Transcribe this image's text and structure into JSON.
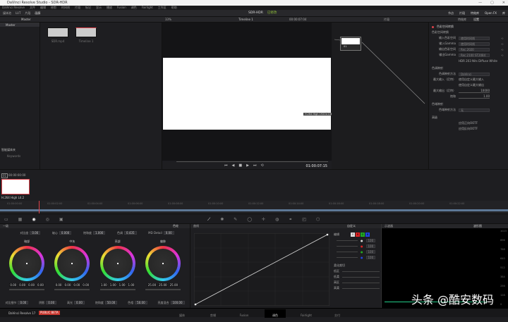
{
  "window": {
    "title": "DaVinci Resolve Studio - SDR-HDR",
    "controls": [
      "—",
      "▢",
      "✕"
    ]
  },
  "menu": [
    "DaVinci Resolve",
    "文件",
    "编辑",
    "修剪",
    "时间线",
    "片段",
    "标记",
    "显示",
    "播放",
    "Fusion",
    "调色",
    "Fairlight",
    "工作区",
    "帮助"
  ],
  "toolbar": {
    "left": [
      "媒体池",
      "LUT",
      "片段",
      "画廊"
    ],
    "project": "SDR-HDR",
    "status": "已修改",
    "right": [
      "节点",
      "片段",
      "特效库",
      "Open FX",
      "库"
    ]
  },
  "media_pool": {
    "header": "Master",
    "bin": "Master",
    "clips": [
      "SDR.mp4",
      "Timeline 1"
    ],
    "smart_bins": "智能媒体夹",
    "keywords": "Keywords"
  },
  "viewer": {
    "zoom": "33%",
    "timeline": "Timeline 1",
    "timecode_top": "00:00:07:04",
    "timecode": "01:00:07:15",
    "overlay": "H.264 High 1920×1080"
  },
  "nodes": {
    "mode": "片段",
    "node_label": "01"
  },
  "right_panel": {
    "tabs": [
      "特效库",
      "设置"
    ],
    "section1": "色彩空间转换",
    "group_input": "色彩空间转换",
    "rows": [
      {
        "label": "输入色彩空间",
        "value": "使用时间线"
      },
      {
        "label": "输入Gamma",
        "value": "使用时间线"
      },
      {
        "label": "输出色彩空间",
        "value": "Rec.2020"
      },
      {
        "label": "输出Gamma",
        "value": "Rec.2100 ST2084"
      }
    ],
    "hdr_note": "HDR 203 Nits Diffuse White",
    "tone_section": "色调映射",
    "tone_rows": [
      {
        "label": "色调映射方法",
        "value": "DaVinci"
      },
      {
        "label": "最大输入（尼特）",
        "value": "使用自定义最大输入"
      },
      {
        "label": "",
        "value": "使用自定义最大输出"
      },
      {
        "label": "最大输出（尼特）",
        "value": "10000"
      },
      {
        "label": "饱和",
        "value": "1.00"
      }
    ],
    "gamut_section": "色域映射",
    "gamut_row": {
      "label": "色域映射方法",
      "value": "无"
    },
    "adv_section": "高级",
    "checks": [
      "应用正向OOTF",
      "应用反向OOTF"
    ]
  },
  "clip_strip": {
    "clip_num": "01",
    "timecode": "00:00:00:00",
    "codec": "H.264 High L4.2"
  },
  "ruler": [
    "01:00:00:00",
    "01:00:02:00",
    "01:00:04:00",
    "01:00:06:00",
    "01:00:08:00",
    "01:00:10:00",
    "01:00:12:00",
    "01:00:14:00",
    "01:00:16:00",
    "01:00:18:00",
    "01:00:20:00",
    "01:00:22:00"
  ],
  "primaries": {
    "title": "一级",
    "mode": "色轮",
    "top": [
      {
        "label": "对比度",
        "value": "0.00"
      },
      {
        "label": "轴心",
        "value": "0.000"
      },
      {
        "label": "饱和度",
        "value": "1.000"
      },
      {
        "label": "色调",
        "value": "0.435"
      },
      {
        "label": "MD Detail",
        "value": "0.00"
      }
    ],
    "wheels": [
      {
        "name": "暗部",
        "values": [
          "0.00",
          "0.00",
          "0.00",
          "0.00"
        ]
      },
      {
        "name": "中灰",
        "values": [
          "0.00",
          "0.00",
          "0.00",
          "0.00"
        ]
      },
      {
        "name": "亮部",
        "values": [
          "1.00",
          "1.00",
          "1.00",
          "1.00"
        ]
      },
      {
        "name": "偏移",
        "values": [
          "25.00",
          "25.00",
          "25.00"
        ]
      }
    ],
    "bottom": [
      {
        "label": "对比细节",
        "value": "0.00"
      },
      {
        "label": "阴影",
        "value": "0.00"
      },
      {
        "label": "高光",
        "value": "0.00"
      },
      {
        "label": "饱和度",
        "value": "50.00"
      },
      {
        "label": "色相",
        "value": "50.00"
      },
      {
        "label": "亮度混合",
        "value": "100.00"
      }
    ]
  },
  "curves": {
    "title": "曲线",
    "mode": "自定义",
    "edit": "编辑",
    "channels": [
      "Y",
      "R",
      "G",
      "B"
    ],
    "values": [
      "100",
      "100",
      "100",
      "100"
    ],
    "soft_clip": "柔化裁切",
    "sliders": [
      "低区",
      "低柔",
      "高区",
      "高柔"
    ]
  },
  "scope": {
    "title": "示波器",
    "mode": "波形图",
    "ticks": [
      "1023",
      "896",
      "768",
      "640",
      "512",
      "384",
      "256",
      "128",
      "0"
    ]
  },
  "pagenav": [
    "媒体",
    "剪辑",
    "Fusion",
    "调色",
    "Fairlight",
    "交付"
  ],
  "app": {
    "name": "DaVinci Resolve 17",
    "badge": "PUBLIC BETA"
  },
  "watermark": "头条 @酷安数码",
  "colors": {
    "accent": "#e0424a",
    "status": "#8fbf3a"
  }
}
